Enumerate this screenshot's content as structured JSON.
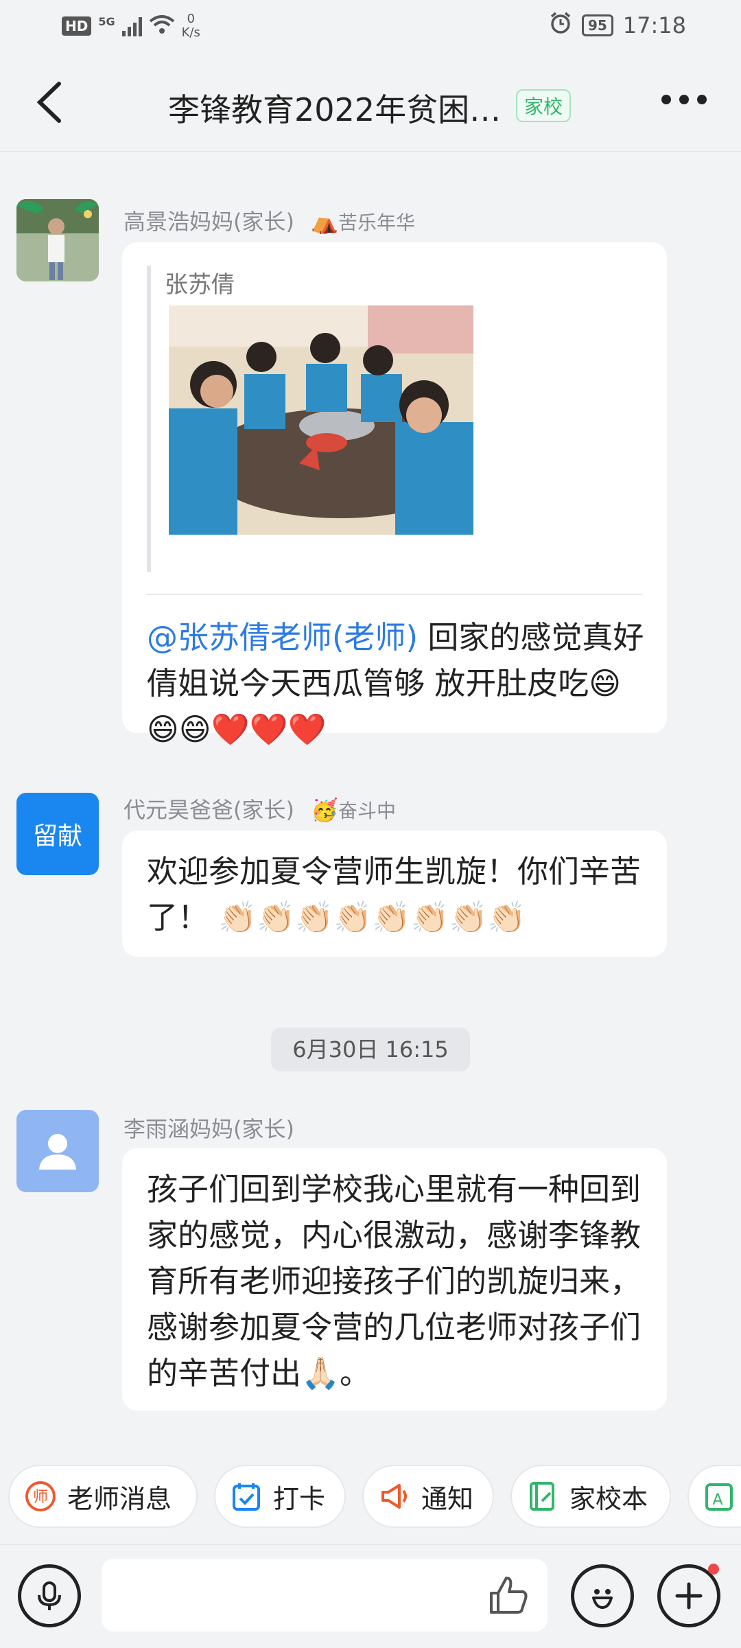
{
  "status_bar": {
    "hd": "HD",
    "network": "5G",
    "speed_value": "0",
    "speed_unit": "K/s",
    "battery": "95",
    "time": "17:18"
  },
  "header": {
    "title": "李锋教育2022年贫困…",
    "tag": "家校"
  },
  "messages": [
    {
      "sender": "高景浩妈妈(家长)",
      "badge": "苦乐年华",
      "quote_name": "张苏倩",
      "mention": "@张苏倩老师(老师)",
      "text": " 回家的感觉真好 倩姐说今天西瓜管够 放开肚皮吃😄😄😄❤️❤️❤️"
    },
    {
      "avatar_text": "留献",
      "sender": "代元昊爸爸(家长)",
      "badge": "奋斗中",
      "text": "欢迎参加夏令营师生凯旋！你们辛苦了！ 👏🏻👏🏻👏🏻👏🏻👏🏻👏🏻👏🏻👏🏻"
    },
    {
      "sender": "李雨涵妈妈(家长)",
      "text": "孩子们回到学校我心里就有一种回到家的感觉，内心很激动，感谢李锋教育所有老师迎接孩子们的凯旋归来，感谢参加夏令营的几位老师对孩子们的辛苦付出🙏🏻。"
    }
  ],
  "time_divider": "6月30日 16:15",
  "quick_actions": [
    "老师消息",
    "打卡",
    "通知",
    "家校本"
  ],
  "colors": {
    "background": "#f2f3f5",
    "accent_blue": "#1a86f0",
    "mention_blue": "#2c7be5",
    "tag_green": "#32b66b",
    "badge_red": "#f04848"
  }
}
